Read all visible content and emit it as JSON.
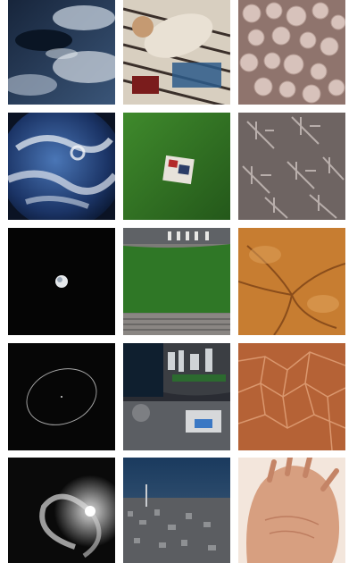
{
  "gallery": {
    "rows": 5,
    "columns": 3,
    "tiles": [
      {
        "subject": "aerial-clouds-and-lake",
        "tone": "#2b3f5c"
      },
      {
        "subject": "man-lying-on-blanket",
        "tone": "#c9b79a"
      },
      {
        "subject": "cells-close-up",
        "tone": "#b59a93"
      },
      {
        "subject": "earth-from-space",
        "tone": "#1d3566"
      },
      {
        "subject": "picnic-blanket-on-grass",
        "tone": "#2f6f22"
      },
      {
        "subject": "fern-like-texture",
        "tone": "#8c827f"
      },
      {
        "subject": "planet-in-darkness",
        "tone": "#050505"
      },
      {
        "subject": "aerial-park-and-marina",
        "tone": "#2c6e21"
      },
      {
        "subject": "skin-texture-close-up",
        "tone": "#c07a30"
      },
      {
        "subject": "orbit-ellipse-in-space",
        "tone": "#060606"
      },
      {
        "subject": "aerial-city-waterfront",
        "tone": "#4a4b52"
      },
      {
        "subject": "cracked-surface-texture",
        "tone": "#b3653a"
      },
      {
        "subject": "spiral-galaxy",
        "tone": "#141414"
      },
      {
        "subject": "city-from-above-at-dusk",
        "tone": "#223b5a"
      },
      {
        "subject": "human-hand",
        "tone": "#d9a78a"
      }
    ]
  }
}
